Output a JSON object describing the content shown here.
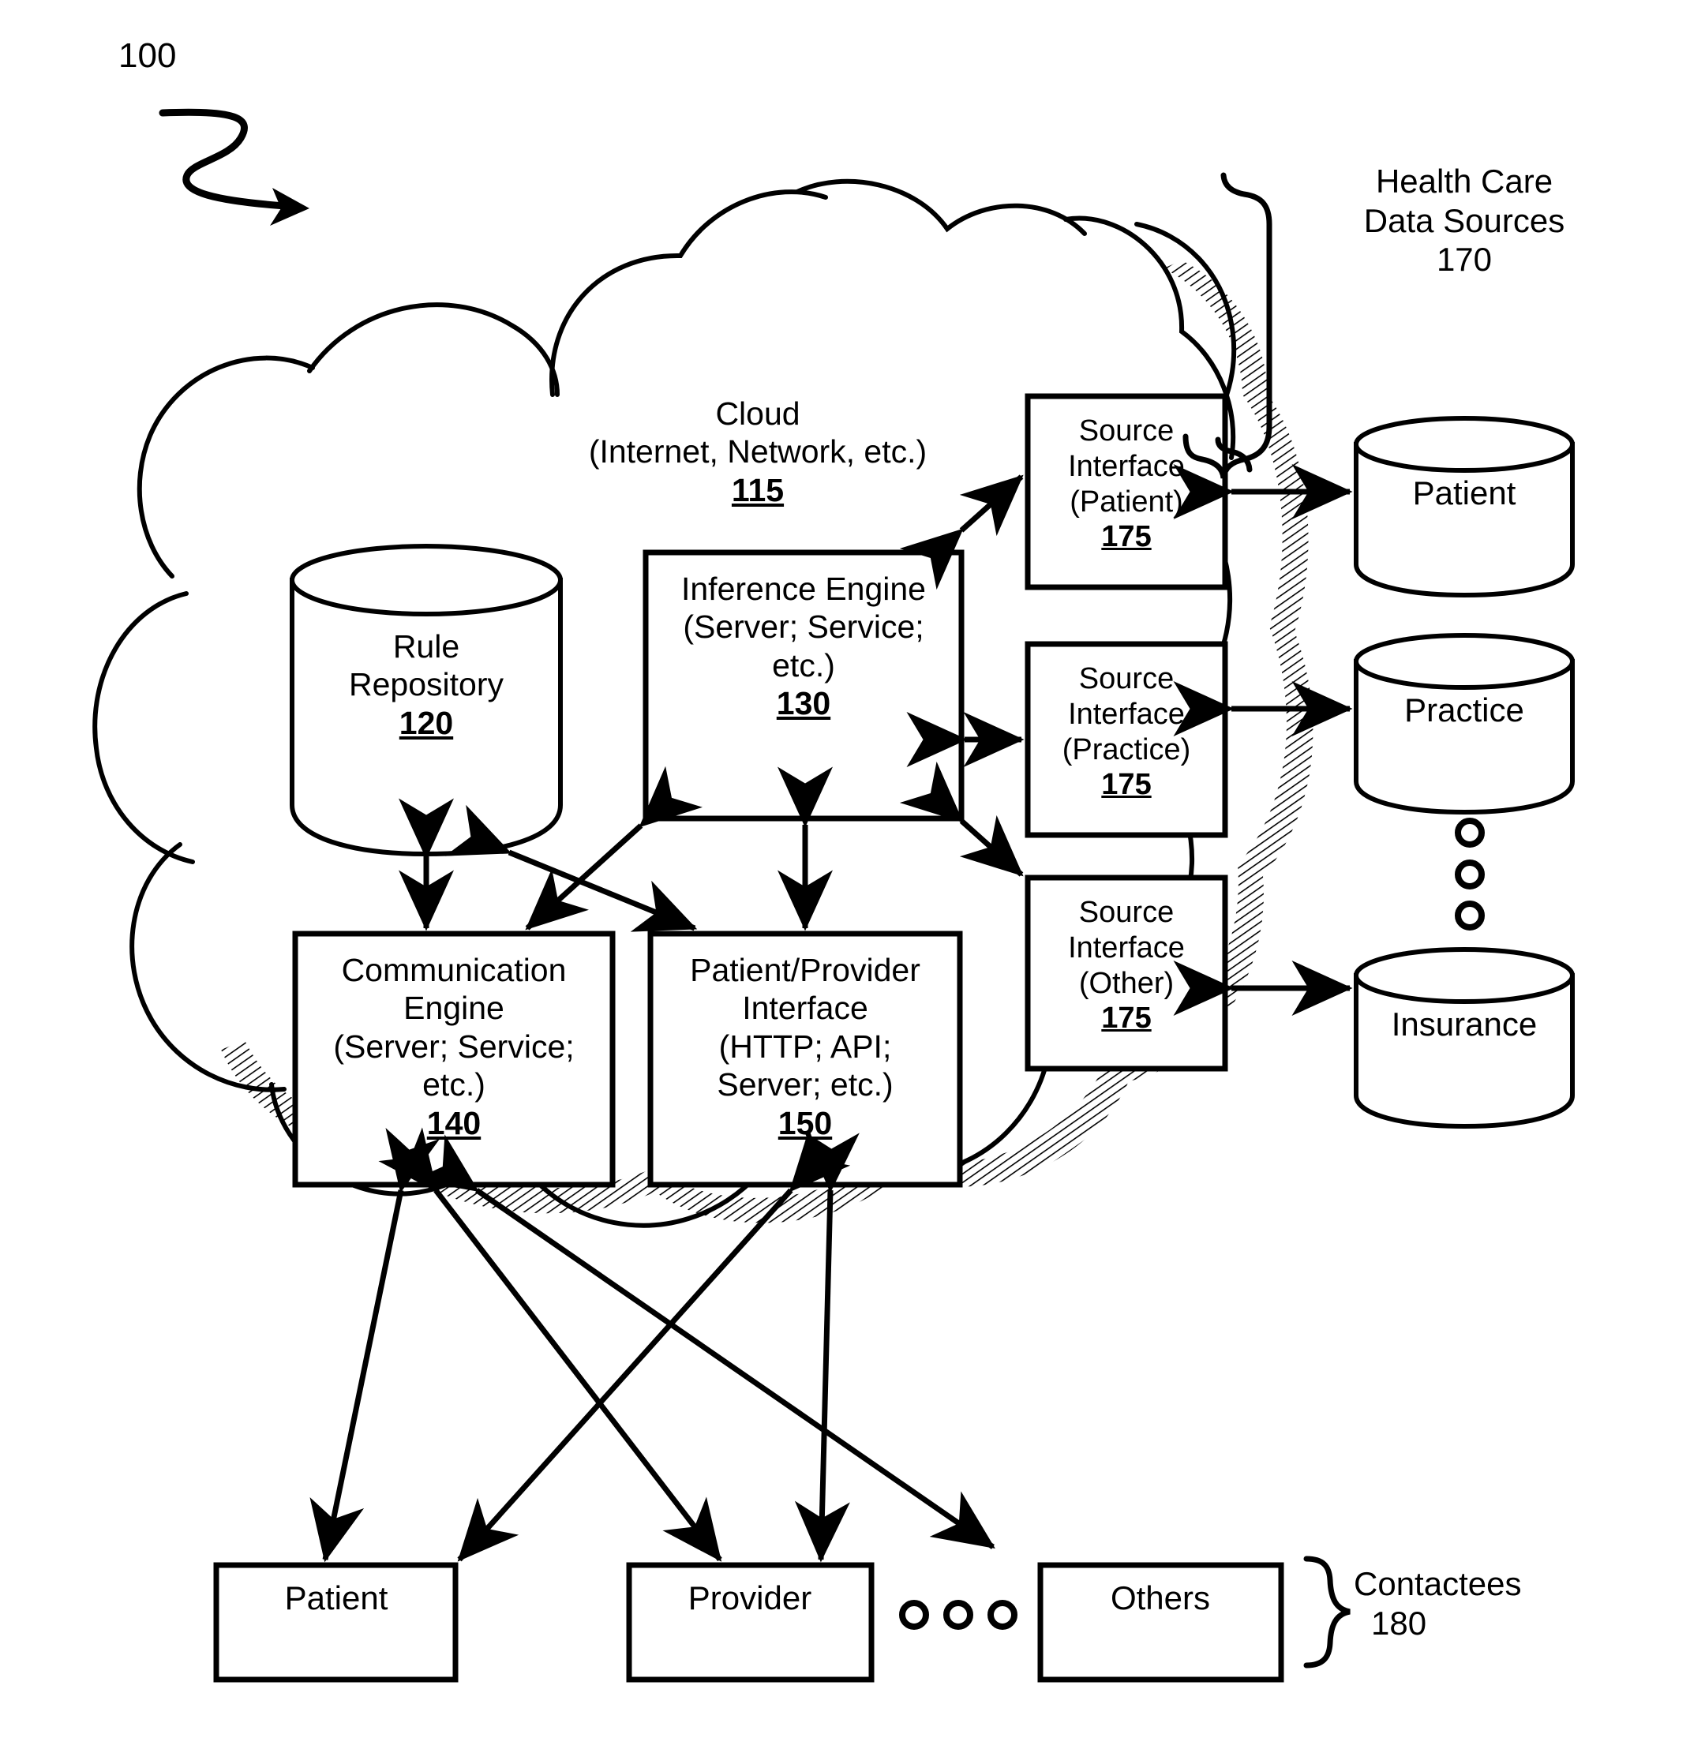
{
  "figure": {
    "number": "100",
    "type": "patent-system-diagram"
  },
  "cloud": {
    "title": "Cloud",
    "subtitle": "(Internet, Network, etc.)",
    "ref": "115"
  },
  "nodes": {
    "rule_repository": {
      "label_line1": "Rule",
      "label_line2": "Repository",
      "ref": "120",
      "shape": "cylinder"
    },
    "inference_engine": {
      "label_line1": "Inference Engine",
      "label_line2": "(Server; Service;",
      "label_line3": "etc.)",
      "ref": "130",
      "shape": "rect"
    },
    "communication_engine": {
      "label_line1": "Communication",
      "label_line2": "Engine",
      "label_line3": "(Server; Service;",
      "label_line4": "etc.)",
      "ref": "140",
      "shape": "rect"
    },
    "patient_provider_interface": {
      "label_line1": "Patient/Provider",
      "label_line2": "Interface",
      "label_line3": "(HTTP; API;",
      "label_line4": "Server; etc.)",
      "ref": "150",
      "shape": "rect"
    }
  },
  "source_interfaces": [
    {
      "label_line1": "Source",
      "label_line2": "Interface",
      "label_line3": "(Patient)",
      "ref": "175"
    },
    {
      "label_line1": "Source",
      "label_line2": "Interface",
      "label_line3": "(Practice)",
      "ref": "175"
    },
    {
      "label_line1": "Source",
      "label_line2": "Interface",
      "label_line3": "(Other)",
      "ref": "175"
    }
  ],
  "data_sources": {
    "group_title_line1": "Health Care",
    "group_title_line2": "Data Sources",
    "group_ref": "170",
    "items": [
      {
        "label": "Patient"
      },
      {
        "label": "Practice"
      },
      {
        "label": "Insurance"
      }
    ],
    "ellipsis": "vertical-three-dots"
  },
  "contactees": {
    "group_title": "Contactees",
    "group_ref": "180",
    "items": [
      {
        "label": "Patient"
      },
      {
        "label": "Provider"
      },
      {
        "label": "Others"
      }
    ],
    "ellipsis": "horizontal-three-dots"
  },
  "style": {
    "stroke": "#000000",
    "fill": "#ffffff",
    "line_width": 5
  }
}
